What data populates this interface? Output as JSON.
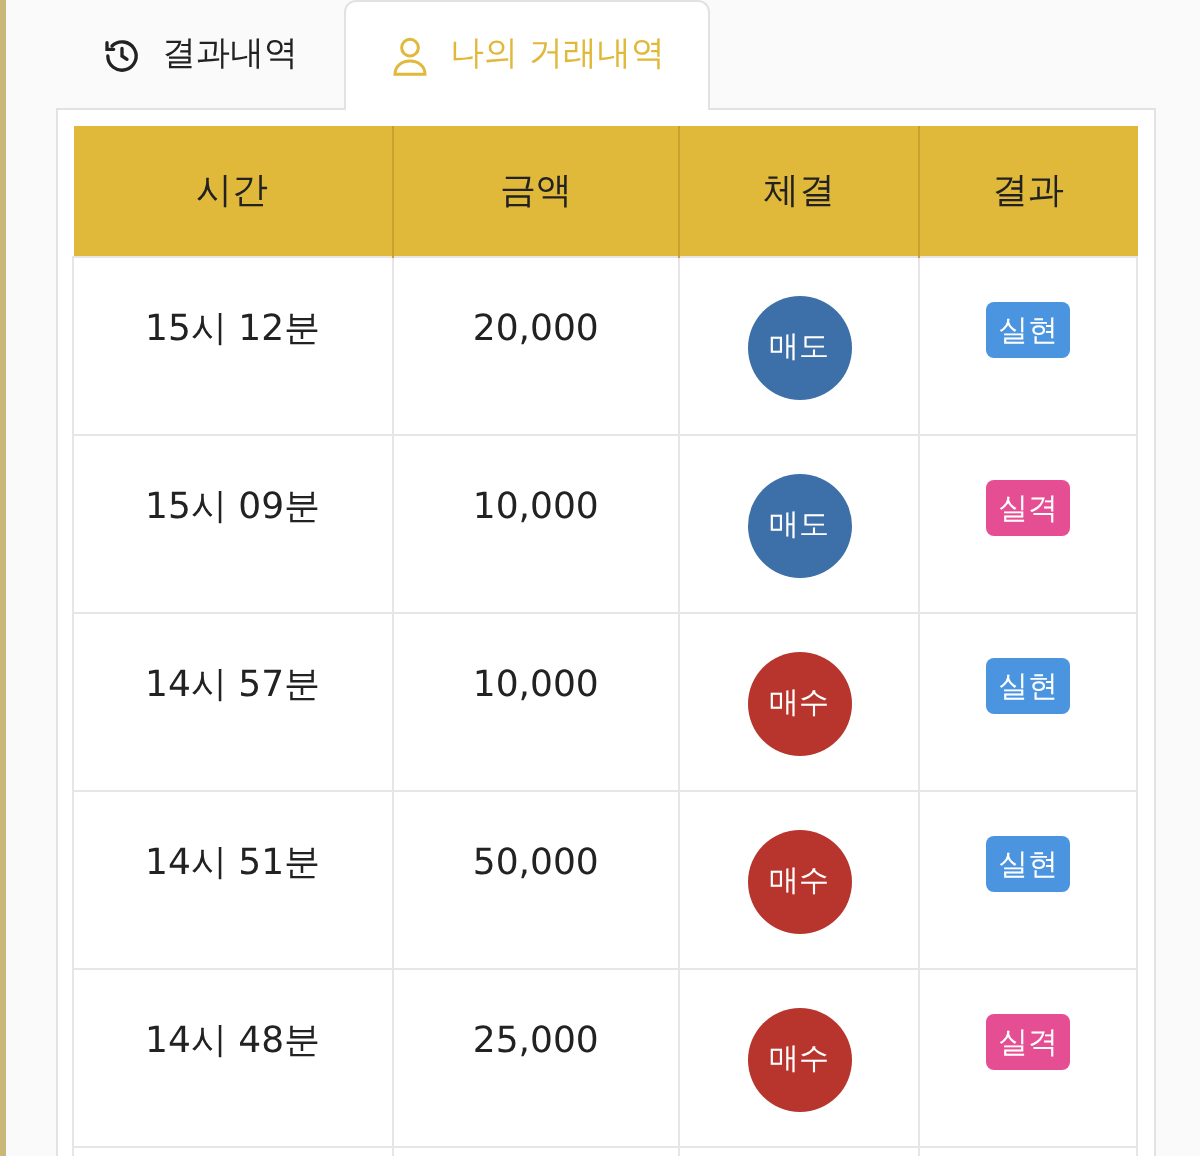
{
  "tabs": [
    {
      "label": "결과내역",
      "kind": "history",
      "selected": false
    },
    {
      "label": "나의 거래내역",
      "kind": "user",
      "selected": true
    }
  ],
  "table": {
    "columns": [
      "시간",
      "금액",
      "체결",
      "결과"
    ],
    "rows": [
      {
        "time": "15시 12분",
        "amount": "20,000",
        "side": {
          "label": "매도",
          "kind": "sell"
        },
        "result": {
          "label": "실현",
          "kind": "win"
        }
      },
      {
        "time": "15시 09분",
        "amount": "10,000",
        "side": {
          "label": "매도",
          "kind": "sell"
        },
        "result": {
          "label": "실격",
          "kind": "loss"
        }
      },
      {
        "time": "14시 57분",
        "amount": "10,000",
        "side": {
          "label": "매수",
          "kind": "buy"
        },
        "result": {
          "label": "실현",
          "kind": "win"
        }
      },
      {
        "time": "14시 51분",
        "amount": "50,000",
        "side": {
          "label": "매수",
          "kind": "buy"
        },
        "result": {
          "label": "실현",
          "kind": "win"
        }
      },
      {
        "time": "14시 48분",
        "amount": "25,000",
        "side": {
          "label": "매수",
          "kind": "buy"
        },
        "result": {
          "label": "실격",
          "kind": "loss"
        }
      }
    ]
  }
}
